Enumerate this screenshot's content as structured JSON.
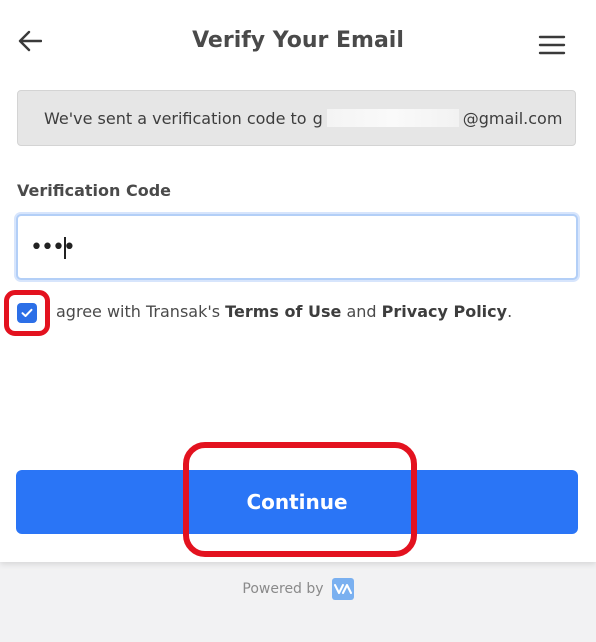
{
  "header": {
    "title": "Verify Your Email",
    "back_icon": "arrow-left-icon",
    "menu_icon": "hamburger-menu-icon"
  },
  "notice": {
    "prefix": "We've sent a verification code to",
    "email_visible_part": "g",
    "email_suffix": "@gmail.com"
  },
  "form": {
    "code_label": "Verification Code",
    "code_value": "••••",
    "agree": {
      "checked": true,
      "prefix": "agree with Transak's",
      "terms_link": "Terms of Use",
      "and": "and",
      "privacy_link": "Privacy Policy",
      "suffix": "."
    },
    "continue_label": "Continue"
  },
  "footer": {
    "powered_by": "Powered by",
    "logo_icon": "transak-logo-icon"
  },
  "colors": {
    "primary": "#2a75f6",
    "annotation_red": "#e3121f",
    "checkbox": "#2c6fe7"
  }
}
